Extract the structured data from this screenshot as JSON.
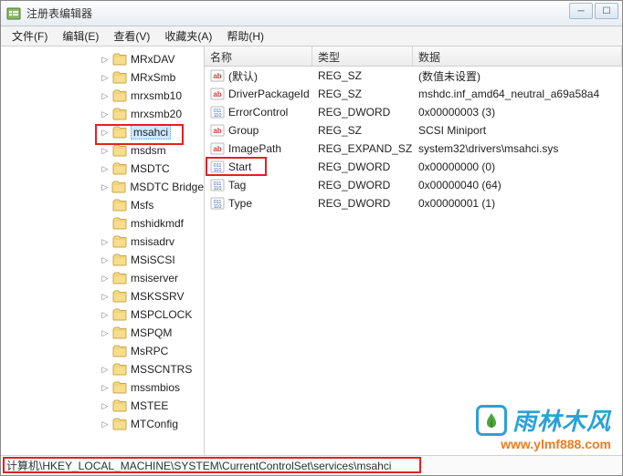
{
  "window": {
    "title": "注册表编辑器"
  },
  "menubar": {
    "items": [
      {
        "label": "文件(F)"
      },
      {
        "label": "编辑(E)"
      },
      {
        "label": "查看(V)"
      },
      {
        "label": "收藏夹(A)"
      },
      {
        "label": "帮助(H)"
      }
    ]
  },
  "tree": {
    "items": [
      {
        "label": "MRxDAV",
        "exp": "▷"
      },
      {
        "label": "MRxSmb",
        "exp": "▷"
      },
      {
        "label": "mrxsmb10",
        "exp": "▷"
      },
      {
        "label": "mrxsmb20",
        "exp": "▷"
      },
      {
        "label": "msahci",
        "exp": "▷",
        "selected": true
      },
      {
        "label": "msdsm",
        "exp": "▷"
      },
      {
        "label": "MSDTC",
        "exp": "▷"
      },
      {
        "label": "MSDTC Bridge",
        "exp": "▷"
      },
      {
        "label": "Msfs",
        "exp": ""
      },
      {
        "label": "mshidkmdf",
        "exp": ""
      },
      {
        "label": "msisadrv",
        "exp": "▷"
      },
      {
        "label": "MSiSCSI",
        "exp": "▷"
      },
      {
        "label": "msiserver",
        "exp": "▷"
      },
      {
        "label": "MSKSSRV",
        "exp": "▷"
      },
      {
        "label": "MSPCLOCK",
        "exp": "▷"
      },
      {
        "label": "MSPQM",
        "exp": "▷"
      },
      {
        "label": "MsRPC",
        "exp": ""
      },
      {
        "label": "MSSCNTRS",
        "exp": "▷"
      },
      {
        "label": "mssmbios",
        "exp": "▷"
      },
      {
        "label": "MSTEE",
        "exp": "▷"
      },
      {
        "label": "MTConfig",
        "exp": "▷"
      }
    ]
  },
  "list": {
    "columns": {
      "name": "名称",
      "type": "类型",
      "data": "数据"
    },
    "rows": [
      {
        "icon": "str",
        "name": "(默认)",
        "type": "REG_SZ",
        "data": "(数值未设置)"
      },
      {
        "icon": "str",
        "name": "DriverPackageId",
        "type": "REG_SZ",
        "data": "mshdc.inf_amd64_neutral_a69a58a4"
      },
      {
        "icon": "bin",
        "name": "ErrorControl",
        "type": "REG_DWORD",
        "data": "0x00000003 (3)"
      },
      {
        "icon": "str",
        "name": "Group",
        "type": "REG_SZ",
        "data": "SCSI Miniport"
      },
      {
        "icon": "str",
        "name": "ImagePath",
        "type": "REG_EXPAND_SZ",
        "data": "system32\\drivers\\msahci.sys"
      },
      {
        "icon": "bin",
        "name": "Start",
        "type": "REG_DWORD",
        "data": "0x00000000 (0)",
        "highlight": true
      },
      {
        "icon": "bin",
        "name": "Tag",
        "type": "REG_DWORD",
        "data": "0x00000040 (64)"
      },
      {
        "icon": "bin",
        "name": "Type",
        "type": "REG_DWORD",
        "data": "0x00000001 (1)"
      }
    ]
  },
  "statusbar": {
    "path": "计算机\\HKEY_LOCAL_MACHINE\\SYSTEM\\CurrentControlSet\\services\\msahci"
  },
  "watermark": {
    "brand_cn": "雨林木风",
    "url": "www.ylmf888.com"
  }
}
